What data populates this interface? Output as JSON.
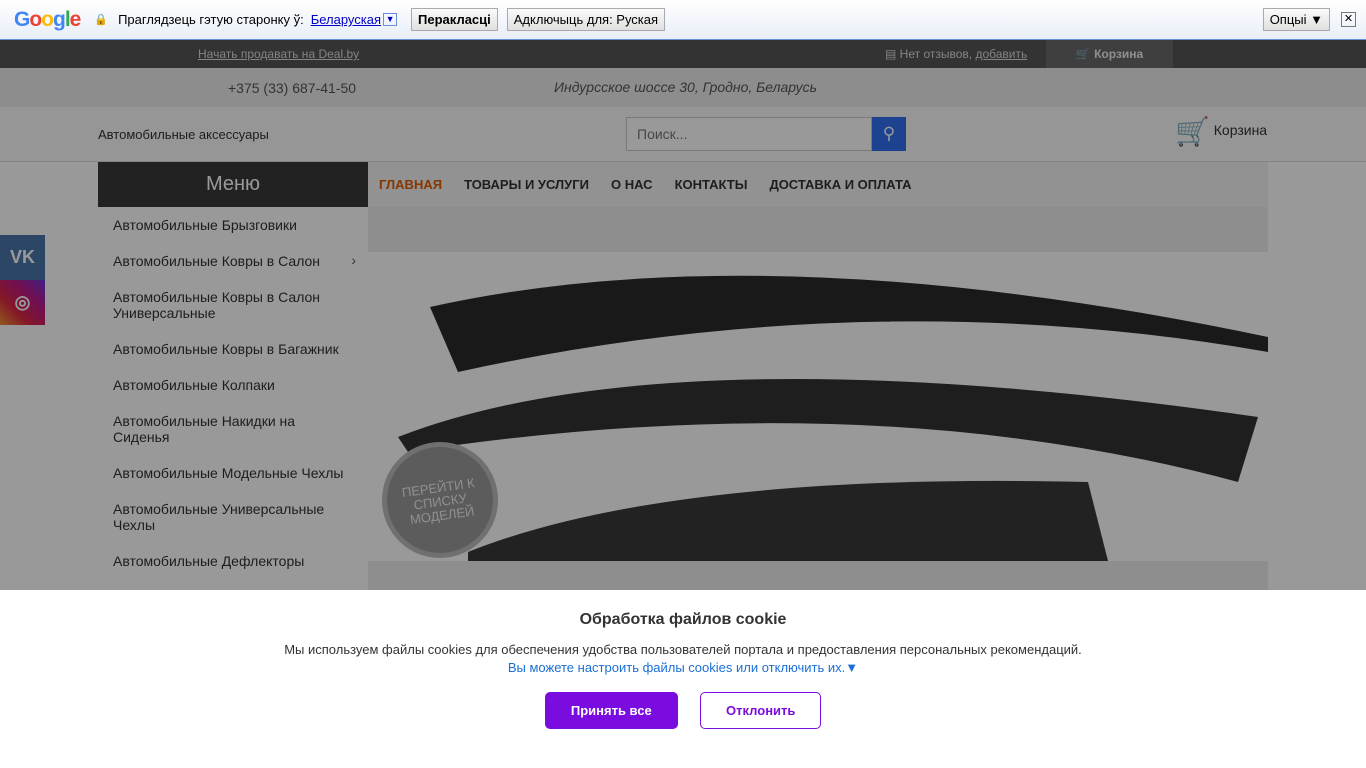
{
  "translate_bar": {
    "logo": "Google",
    "prompt": "Праглядзець гэтую старонку ў:",
    "language": "Беларуская",
    "translate_btn": "Перакласці",
    "disable_btn": "Адключыць для: Руская",
    "options_btn": "Опцыі ▼",
    "close": "✕"
  },
  "topbar": {
    "sell_link": "Начать продавать на Deal.by",
    "reviews": "Нет отзывов,",
    "add_review": "добавить",
    "cart": "Корзина"
  },
  "contacts": {
    "phone": "+375 (33) 687-41-50",
    "address": "Индурсское шоссе 30, Гродно, Беларусь"
  },
  "header": {
    "category": "Автомобильные аксессуары",
    "search_placeholder": "Поиск...",
    "cart": "Корзина"
  },
  "menu": {
    "title": "Меню",
    "items": [
      "Автомобильные Брызговики",
      "Автомобильные Ковры в Салон",
      "Автомобильные Ковры в Салон Универсальные",
      "Автомобильные Ковры в Багажник",
      "Автомобильные Колпаки",
      "Автомобильные Накидки на Сиденья",
      "Автомобильные Модельные Чехлы",
      "Автомобильные Универсальные Чехлы",
      "Автомобильные Дефлекторы"
    ]
  },
  "nav": [
    "ГЛАВНАЯ",
    "ТОВАРЫ И УСЛУГИ",
    "О НАС",
    "КОНТАКТЫ",
    "ДОСТАВКА И ОПЛАТА"
  ],
  "banner": {
    "badge": "ПЕРЕЙТИ К СПИСКУ МОДЕЛЕЙ"
  },
  "social": {
    "vk": "VK",
    "instagram": "◎"
  },
  "cookie": {
    "title": "Обработка файлов cookie",
    "text": "Мы используем файлы cookies для обеспечения удобства пользователей портала и предоставления персональных рекомендаций.",
    "link": "Вы можете настроить файлы cookies или отключить их.▼",
    "accept": "Принять все",
    "reject": "Отклонить"
  }
}
